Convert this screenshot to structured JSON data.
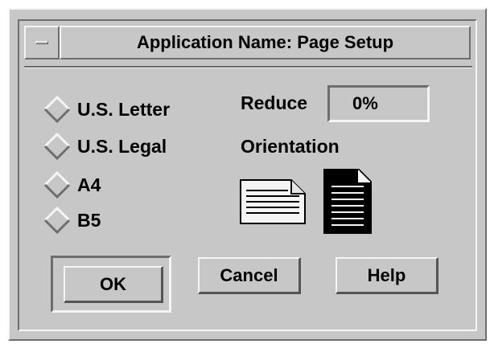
{
  "window": {
    "title": "Application Name: Page Setup"
  },
  "paper_size": {
    "options": [
      "U.S. Letter",
      "U.S. Legal",
      "A4",
      "B5"
    ],
    "selected": null
  },
  "reduce": {
    "label": "Reduce",
    "value": "0%"
  },
  "orientation": {
    "label": "Orientation",
    "options": [
      "landscape",
      "portrait"
    ],
    "selected": "portrait"
  },
  "buttons": {
    "ok_label": "OK",
    "cancel_label": "Cancel",
    "help_label": "Help",
    "default": "OK"
  },
  "colors": {
    "background": "#c7c7c7",
    "highlight": "#f5f5f5",
    "shadow": "#6e6e6e",
    "selected_icon": "#000000"
  }
}
